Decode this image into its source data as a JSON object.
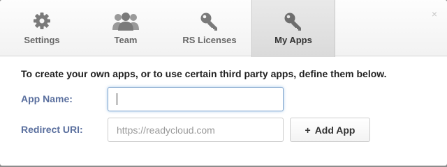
{
  "tabs": [
    {
      "label": "Settings",
      "icon": "gear-icon"
    },
    {
      "label": "Team",
      "icon": "team-icon"
    },
    {
      "label": "RS Licenses",
      "icon": "key-icon"
    },
    {
      "label": "My Apps",
      "icon": "key-icon",
      "active": true
    }
  ],
  "close_glyph": "×",
  "intro": "To create your own apps, or to use certain third party apps, define them below.",
  "form": {
    "app_name_label": "App Name:",
    "app_name_value": "",
    "redirect_uri_label": "Redirect URI:",
    "redirect_uri_placeholder": "https://readycloud.com",
    "add_app_icon": "+",
    "add_app_label": "Add App"
  },
  "colors": {
    "label": "#5a6f9e",
    "focus_border": "#7fa4cc",
    "icon": "#7a7a7a"
  }
}
